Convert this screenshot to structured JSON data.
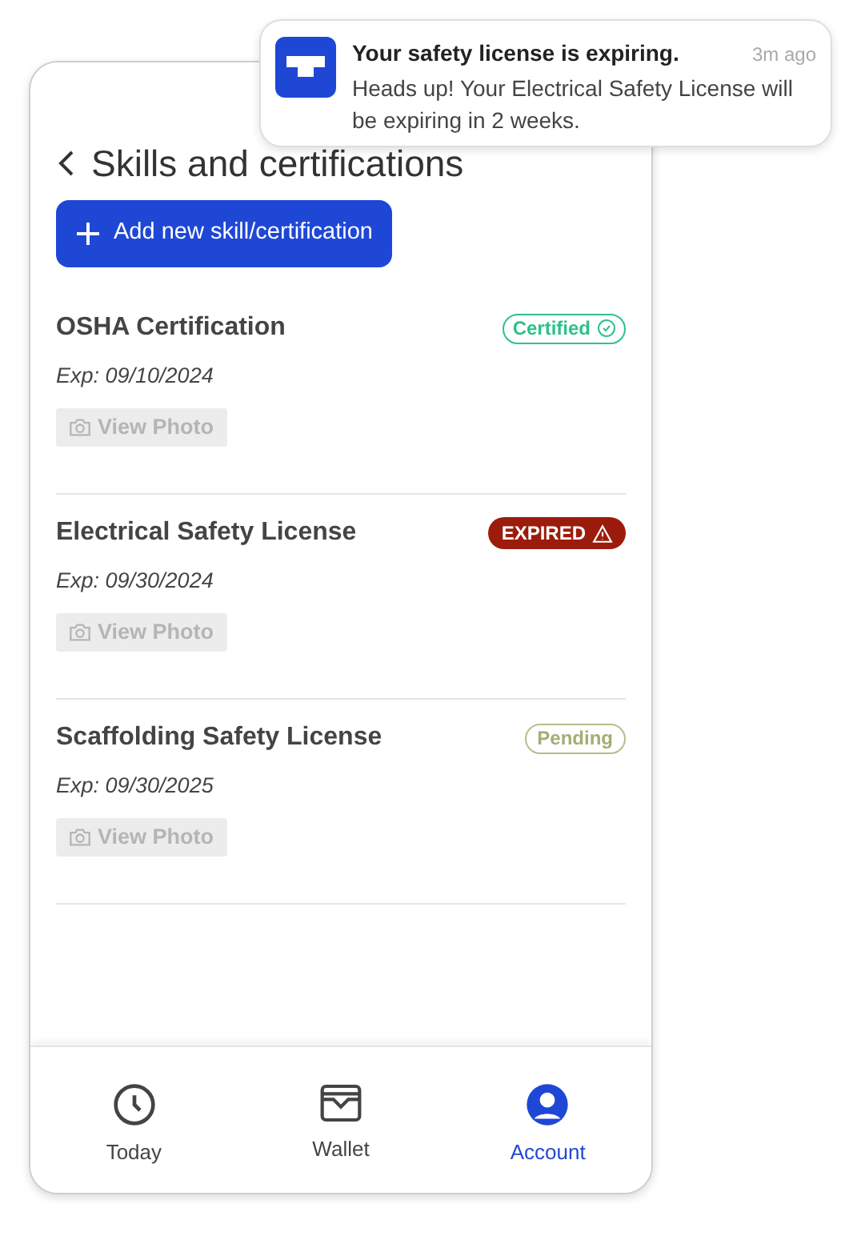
{
  "notification": {
    "title": "Your safety license is expiring.",
    "time": "3m ago",
    "body": "Heads up! Your Electrical Safety License will be expiring in 2 weeks."
  },
  "header": {
    "title": "Skills and certifications"
  },
  "add_button": {
    "label": "Add new skill/certification"
  },
  "items": [
    {
      "name": "OSHA Certification",
      "status": {
        "kind": "certified",
        "label": "Certified"
      },
      "expiry": "Exp: 09/10/2024",
      "photo_button": "View Photo"
    },
    {
      "name": "Electrical Safety License",
      "status": {
        "kind": "expired",
        "label": "EXPIRED"
      },
      "expiry": "Exp: 09/30/2024",
      "photo_button": "View Photo"
    },
    {
      "name": "Scaffolding Safety License",
      "status": {
        "kind": "pending",
        "label": "Pending"
      },
      "expiry": "Exp: 09/30/2025",
      "photo_button": "View Photo"
    }
  ],
  "nav": [
    {
      "kind": "today",
      "label": "Today",
      "selected": false
    },
    {
      "kind": "wallet",
      "label": "Wallet",
      "selected": false
    },
    {
      "kind": "account",
      "label": "Account",
      "selected": true
    }
  ]
}
